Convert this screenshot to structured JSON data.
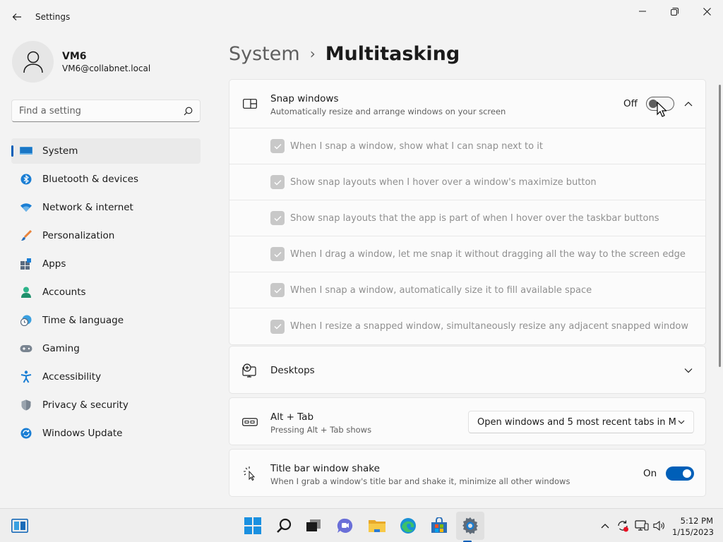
{
  "window": {
    "title": "Settings"
  },
  "profile": {
    "name": "VM6",
    "email": "VM6@collabnet.local"
  },
  "search": {
    "placeholder": "Find a setting"
  },
  "nav": [
    {
      "label": "System",
      "icon": "monitor-icon",
      "selected": true
    },
    {
      "label": "Bluetooth & devices",
      "icon": "bluetooth-icon"
    },
    {
      "label": "Network & internet",
      "icon": "wifi-icon"
    },
    {
      "label": "Personalization",
      "icon": "brush-icon"
    },
    {
      "label": "Apps",
      "icon": "apps-icon"
    },
    {
      "label": "Accounts",
      "icon": "person-icon"
    },
    {
      "label": "Time & language",
      "icon": "clock-globe-icon"
    },
    {
      "label": "Gaming",
      "icon": "gamepad-icon"
    },
    {
      "label": "Accessibility",
      "icon": "accessibility-icon"
    },
    {
      "label": "Privacy & security",
      "icon": "shield-icon"
    },
    {
      "label": "Windows Update",
      "icon": "update-icon"
    }
  ],
  "breadcrumb": {
    "parent": "System",
    "separator": "›",
    "current": "Multitasking"
  },
  "snap": {
    "title": "Snap windows",
    "description": "Automatically resize and arrange windows on your screen",
    "state_label": "Off",
    "enabled": false,
    "options": [
      "When I snap a window, show what I can snap next to it",
      "Show snap layouts when I hover over a window's maximize button",
      "Show snap layouts that the app is part of when I hover over the taskbar buttons",
      "When I drag a window, let me snap it without dragging all the way to the screen edge",
      "When I snap a window, automatically size it to fill available space",
      "When I resize a snapped window, simultaneously resize any adjacent snapped window"
    ]
  },
  "desktops": {
    "title": "Desktops"
  },
  "alttab": {
    "title": "Alt + Tab",
    "description": "Pressing Alt + Tab shows",
    "selected": "Open windows and 5 most recent tabs in M"
  },
  "shake": {
    "title": "Title bar window shake",
    "description": "When I grab a window's title bar and shake it, minimize all other windows",
    "state_label": "On",
    "enabled": true
  },
  "taskbar": {
    "time": "5:12 PM",
    "date": "1/15/2023",
    "accent": "#005fb8"
  }
}
